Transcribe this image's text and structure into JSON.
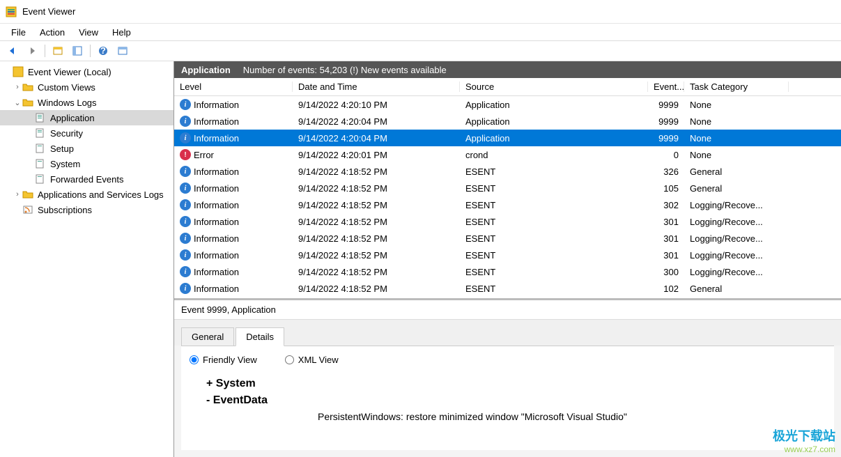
{
  "window": {
    "title": "Event Viewer"
  },
  "menu": {
    "file": "File",
    "action": "Action",
    "view": "View",
    "help": "Help"
  },
  "tree": {
    "root": "Event Viewer (Local)",
    "custom_views": "Custom Views",
    "windows_logs": "Windows Logs",
    "application": "Application",
    "security": "Security",
    "setup": "Setup",
    "system": "System",
    "forwarded": "Forwarded Events",
    "appservices": "Applications and Services Logs",
    "subscriptions": "Subscriptions"
  },
  "log_header": {
    "name": "Application",
    "count": "Number of events: 54,203 (!) New events available"
  },
  "columns": {
    "level": "Level",
    "date": "Date and Time",
    "source": "Source",
    "event": "Event...",
    "task": "Task Category"
  },
  "events": [
    {
      "level": "Information",
      "icon": "info",
      "date": "9/14/2022 4:20:10 PM",
      "source": "Application",
      "event": "9999",
      "task": "None",
      "selected": false
    },
    {
      "level": "Information",
      "icon": "info",
      "date": "9/14/2022 4:20:04 PM",
      "source": "Application",
      "event": "9999",
      "task": "None",
      "selected": false
    },
    {
      "level": "Information",
      "icon": "info",
      "date": "9/14/2022 4:20:04 PM",
      "source": "Application",
      "event": "9999",
      "task": "None",
      "selected": true
    },
    {
      "level": "Error",
      "icon": "error",
      "date": "9/14/2022 4:20:01 PM",
      "source": "crond",
      "event": "0",
      "task": "None",
      "selected": false
    },
    {
      "level": "Information",
      "icon": "info",
      "date": "9/14/2022 4:18:52 PM",
      "source": "ESENT",
      "event": "326",
      "task": "General",
      "selected": false
    },
    {
      "level": "Information",
      "icon": "info",
      "date": "9/14/2022 4:18:52 PM",
      "source": "ESENT",
      "event": "105",
      "task": "General",
      "selected": false
    },
    {
      "level": "Information",
      "icon": "info",
      "date": "9/14/2022 4:18:52 PM",
      "source": "ESENT",
      "event": "302",
      "task": "Logging/Recove...",
      "selected": false
    },
    {
      "level": "Information",
      "icon": "info",
      "date": "9/14/2022 4:18:52 PM",
      "source": "ESENT",
      "event": "301",
      "task": "Logging/Recove...",
      "selected": false
    },
    {
      "level": "Information",
      "icon": "info",
      "date": "9/14/2022 4:18:52 PM",
      "source": "ESENT",
      "event": "301",
      "task": "Logging/Recove...",
      "selected": false
    },
    {
      "level": "Information",
      "icon": "info",
      "date": "9/14/2022 4:18:52 PM",
      "source": "ESENT",
      "event": "301",
      "task": "Logging/Recove...",
      "selected": false
    },
    {
      "level": "Information",
      "icon": "info",
      "date": "9/14/2022 4:18:52 PM",
      "source": "ESENT",
      "event": "300",
      "task": "Logging/Recove...",
      "selected": false
    },
    {
      "level": "Information",
      "icon": "info",
      "date": "9/14/2022 4:18:52 PM",
      "source": "ESENT",
      "event": "102",
      "task": "General",
      "selected": false
    }
  ],
  "details": {
    "title": "Event 9999, Application",
    "tabs": {
      "general": "General",
      "details": "Details"
    },
    "radios": {
      "friendly": "Friendly View",
      "xml": "XML View"
    },
    "system": "+  System",
    "eventdata": "-  EventData",
    "message": "PersistentWindows: restore minimized window \"Microsoft Visual Studio\""
  },
  "watermark": {
    "line1": "极光下载站",
    "line2": "www.xz7.com"
  }
}
